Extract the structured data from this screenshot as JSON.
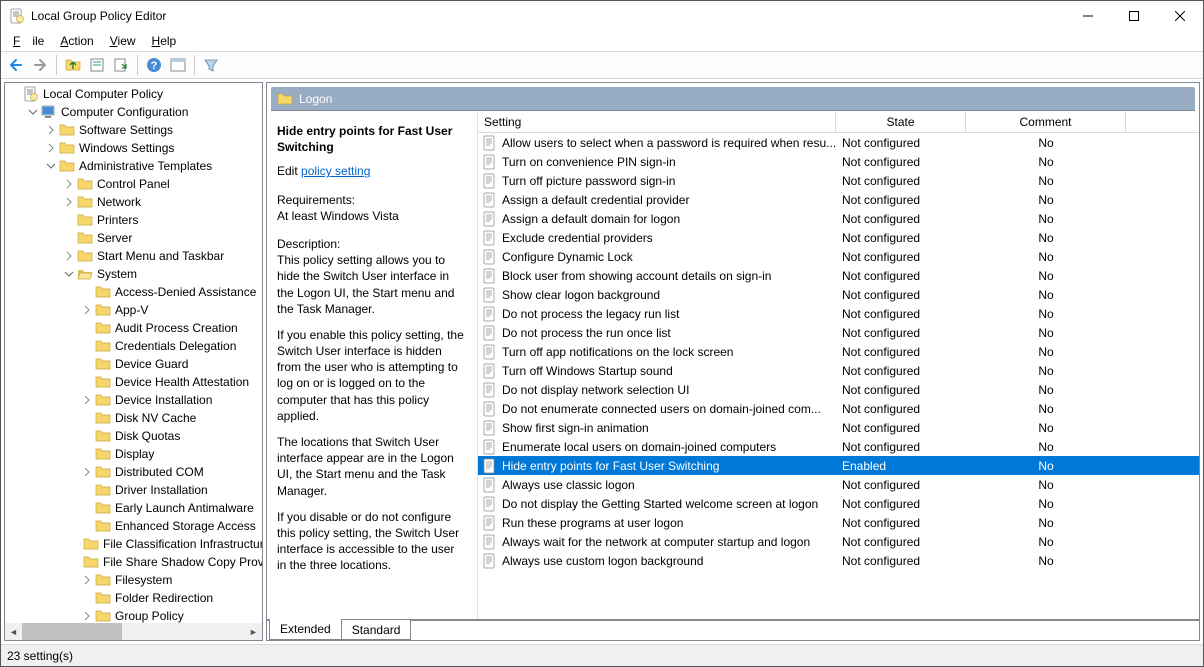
{
  "window": {
    "title": "Local Group Policy Editor"
  },
  "menu": {
    "file": "File",
    "action": "Action",
    "view": "View",
    "help": "Help"
  },
  "tree": [
    {
      "indent": 0,
      "label": "Local Computer Policy",
      "icon": "policy",
      "twi": ""
    },
    {
      "indent": 1,
      "label": "Computer Configuration",
      "icon": "computer",
      "twi": "v"
    },
    {
      "indent": 2,
      "label": "Software Settings",
      "icon": "folder",
      "twi": ">"
    },
    {
      "indent": 2,
      "label": "Windows Settings",
      "icon": "folder",
      "twi": ">"
    },
    {
      "indent": 2,
      "label": "Administrative Templates",
      "icon": "folder",
      "twi": "v"
    },
    {
      "indent": 3,
      "label": "Control Panel",
      "icon": "folder",
      "twi": ">"
    },
    {
      "indent": 3,
      "label": "Network",
      "icon": "folder",
      "twi": ">"
    },
    {
      "indent": 3,
      "label": "Printers",
      "icon": "folder",
      "twi": ""
    },
    {
      "indent": 3,
      "label": "Server",
      "icon": "folder",
      "twi": ""
    },
    {
      "indent": 3,
      "label": "Start Menu and Taskbar",
      "icon": "folder",
      "twi": ">"
    },
    {
      "indent": 3,
      "label": "System",
      "icon": "folderopen",
      "twi": "v"
    },
    {
      "indent": 4,
      "label": "Access-Denied Assistance",
      "icon": "folder",
      "twi": ""
    },
    {
      "indent": 4,
      "label": "App-V",
      "icon": "folder",
      "twi": ">"
    },
    {
      "indent": 4,
      "label": "Audit Process Creation",
      "icon": "folder",
      "twi": ""
    },
    {
      "indent": 4,
      "label": "Credentials Delegation",
      "icon": "folder",
      "twi": ""
    },
    {
      "indent": 4,
      "label": "Device Guard",
      "icon": "folder",
      "twi": ""
    },
    {
      "indent": 4,
      "label": "Device Health Attestation",
      "icon": "folder",
      "twi": ""
    },
    {
      "indent": 4,
      "label": "Device Installation",
      "icon": "folder",
      "twi": ">"
    },
    {
      "indent": 4,
      "label": "Disk NV Cache",
      "icon": "folder",
      "twi": ""
    },
    {
      "indent": 4,
      "label": "Disk Quotas",
      "icon": "folder",
      "twi": ""
    },
    {
      "indent": 4,
      "label": "Display",
      "icon": "folder",
      "twi": ""
    },
    {
      "indent": 4,
      "label": "Distributed COM",
      "icon": "folder",
      "twi": ">"
    },
    {
      "indent": 4,
      "label": "Driver Installation",
      "icon": "folder",
      "twi": ""
    },
    {
      "indent": 4,
      "label": "Early Launch Antimalware",
      "icon": "folder",
      "twi": ""
    },
    {
      "indent": 4,
      "label": "Enhanced Storage Access",
      "icon": "folder",
      "twi": ""
    },
    {
      "indent": 4,
      "label": "File Classification Infrastructure",
      "icon": "folder",
      "twi": ""
    },
    {
      "indent": 4,
      "label": "File Share Shadow Copy Provider",
      "icon": "folder",
      "twi": ""
    },
    {
      "indent": 4,
      "label": "Filesystem",
      "icon": "folder",
      "twi": ">"
    },
    {
      "indent": 4,
      "label": "Folder Redirection",
      "icon": "folder",
      "twi": ""
    },
    {
      "indent": 4,
      "label": "Group Policy",
      "icon": "folder",
      "twi": ">"
    }
  ],
  "category": {
    "title": "Logon"
  },
  "desc": {
    "title": "Hide entry points for Fast User Switching",
    "edit_prefix": "Edit ",
    "edit_link": "policy setting",
    "req_label": "Requirements:",
    "req_text": "At least Windows Vista",
    "d_label": "Description:",
    "d1": "This policy setting allows you to hide the Switch User interface in the Logon UI, the Start menu and the Task Manager.",
    "d2": "If you enable this policy setting, the Switch User interface is hidden from the user who is attempting to log on or is logged on to the computer that has this policy applied.",
    "d3": "The locations that Switch User interface appear are in the Logon UI, the Start menu and the Task Manager.",
    "d4": "If you disable or do not configure this policy setting, the Switch User interface is accessible to the user in the three locations."
  },
  "columns": {
    "setting": "Setting",
    "state": "State",
    "comment": "Comment"
  },
  "col_widths": {
    "c0": 358,
    "c1": 130,
    "c2": 160
  },
  "policies": [
    {
      "name": "Allow users to select when a password is required when resu...",
      "state": "Not configured",
      "comment": "No"
    },
    {
      "name": "Turn on convenience PIN sign-in",
      "state": "Not configured",
      "comment": "No"
    },
    {
      "name": "Turn off picture password sign-in",
      "state": "Not configured",
      "comment": "No"
    },
    {
      "name": "Assign a default credential provider",
      "state": "Not configured",
      "comment": "No"
    },
    {
      "name": "Assign a default domain for logon",
      "state": "Not configured",
      "comment": "No"
    },
    {
      "name": "Exclude credential providers",
      "state": "Not configured",
      "comment": "No"
    },
    {
      "name": "Configure Dynamic Lock",
      "state": "Not configured",
      "comment": "No"
    },
    {
      "name": "Block user from showing account details on sign-in",
      "state": "Not configured",
      "comment": "No"
    },
    {
      "name": "Show clear logon background",
      "state": "Not configured",
      "comment": "No"
    },
    {
      "name": "Do not process the legacy run list",
      "state": "Not configured",
      "comment": "No"
    },
    {
      "name": "Do not process the run once list",
      "state": "Not configured",
      "comment": "No"
    },
    {
      "name": "Turn off app notifications on the lock screen",
      "state": "Not configured",
      "comment": "No"
    },
    {
      "name": "Turn off Windows Startup sound",
      "state": "Not configured",
      "comment": "No"
    },
    {
      "name": "Do not display network selection UI",
      "state": "Not configured",
      "comment": "No"
    },
    {
      "name": "Do not enumerate connected users on domain-joined com...",
      "state": "Not configured",
      "comment": "No"
    },
    {
      "name": "Show first sign-in animation",
      "state": "Not configured",
      "comment": "No"
    },
    {
      "name": "Enumerate local users on domain-joined computers",
      "state": "Not configured",
      "comment": "No"
    },
    {
      "name": "Hide entry points for Fast User Switching",
      "state": "Enabled",
      "comment": "No",
      "sel": true
    },
    {
      "name": "Always use classic logon",
      "state": "Not configured",
      "comment": "No"
    },
    {
      "name": "Do not display the Getting Started welcome screen at logon",
      "state": "Not configured",
      "comment": "No"
    },
    {
      "name": "Run these programs at user logon",
      "state": "Not configured",
      "comment": "No"
    },
    {
      "name": "Always wait for the network at computer startup and logon",
      "state": "Not configured",
      "comment": "No"
    },
    {
      "name": "Always use custom logon background",
      "state": "Not configured",
      "comment": "No"
    }
  ],
  "tabs": {
    "extended": "Extended",
    "standard": "Standard"
  },
  "status": "23 setting(s)"
}
